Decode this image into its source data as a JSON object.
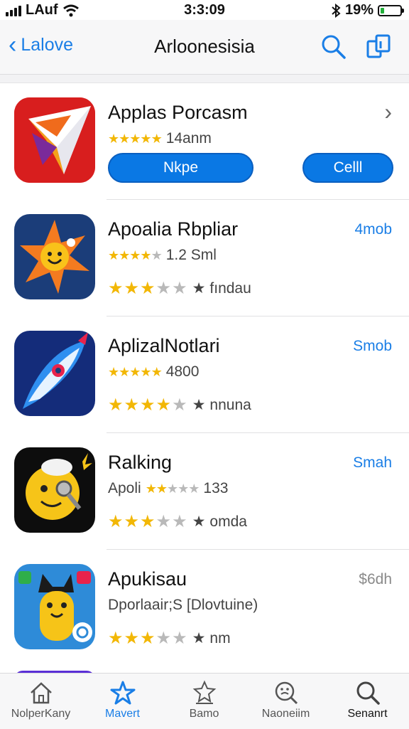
{
  "status": {
    "carrier": "LAuf",
    "time": "3:3:09",
    "battery": "19%",
    "battery_level": 0.19,
    "battery_color": "#23b03a"
  },
  "nav": {
    "back_label": "Lalove",
    "title": "Arloonesisia",
    "search_icon": "search-icon",
    "share_icon": "share-icon"
  },
  "apps": [
    {
      "name": "Applas Porcasm",
      "rating_text": "14anm",
      "stars": 4.5,
      "primary_button": "Nkpe",
      "secondary_button": "Celll"
    },
    {
      "name": "Apoalia Rbpliar",
      "rating_text": "1.2 Sml",
      "stars": 4,
      "stars_row2": 3,
      "row2_text": "fındau",
      "price": "4mob"
    },
    {
      "name": "AplizalNotlari",
      "rating_text": "4800",
      "stars": 4.5,
      "stars_row2": 4,
      "row2_text": "nnuna",
      "price": "Smob"
    },
    {
      "name": "Ralking",
      "rating_prefix": "Apoli",
      "rating_text": "133",
      "stars": 2,
      "stars_row2": 3,
      "row2_text": "omda",
      "price": "Smah"
    },
    {
      "name": "Apukisau",
      "subtitle": "Dporlaair;S [Dlovtuine)",
      "stars_row2": 3,
      "row2_text": "nm",
      "price": "$6dh"
    }
  ],
  "tabs": [
    {
      "label": "NolperKany",
      "icon": "home-icon"
    },
    {
      "label": "Mavert",
      "icon": "star-icon"
    },
    {
      "label": "Bamo",
      "icon": "upload-icon"
    },
    {
      "label": "Naoneiim",
      "icon": "smiley-search-icon"
    },
    {
      "label": "Senanrt",
      "icon": "search-icon"
    }
  ],
  "colors": {
    "accent": "#1a7ee6",
    "star": "#f2b705",
    "button": "#0a78e4"
  }
}
